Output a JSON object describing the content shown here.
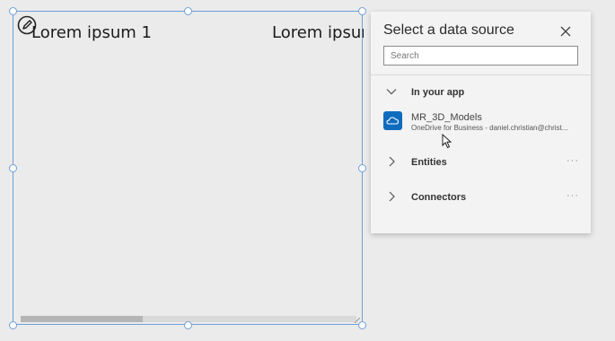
{
  "gallery": {
    "item_titles": [
      "Lorem ipsum 1",
      "Lorem ipsum"
    ]
  },
  "panel": {
    "title": "Select a data source",
    "search_placeholder": "Search",
    "in_your_app": {
      "label": "In your app",
      "items": [
        {
          "name": "MR_3D_Models",
          "subtitle": "OneDrive for Business - daniel.christian@christ..."
        }
      ]
    },
    "groups": [
      {
        "label": "Entities",
        "more": "···"
      },
      {
        "label": "Connectors",
        "more": "···"
      }
    ]
  },
  "icons": {
    "edit": "pencil-circle-icon",
    "close": "close-icon",
    "expanded": "chevron-down-icon",
    "collapsed": "chevron-right-icon",
    "onedrive": "onedrive-cloud-icon",
    "cursor": "mouse-pointer-icon"
  },
  "colors": {
    "selection": "#6f9fd6",
    "onedrive_tile": "#0f6cbd",
    "panel_bg": "#f3f3f3",
    "canvas_bg": "#ebebeb"
  }
}
